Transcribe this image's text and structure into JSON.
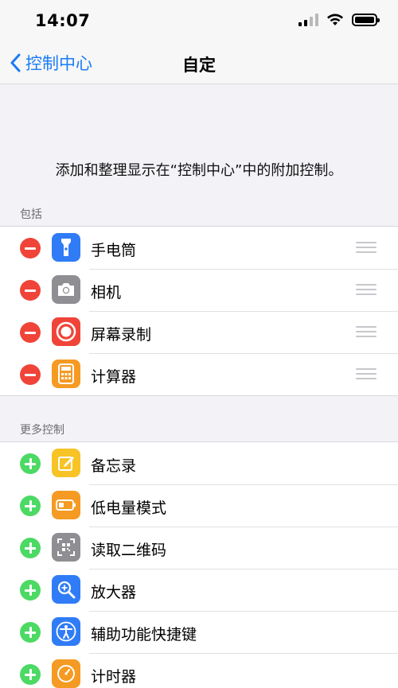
{
  "status_bar": {
    "time": "14:07"
  },
  "nav": {
    "back_label": "控制中心",
    "title": "自定"
  },
  "description": "添加和整理显示在“控制中心”中的附加控制。",
  "included": {
    "header": "包括",
    "items": [
      {
        "label": "手电筒",
        "icon": "flashlight-icon",
        "color": "#2f7cf6"
      },
      {
        "label": "相机",
        "icon": "camera-icon",
        "color": "#8e8e93"
      },
      {
        "label": "屏幕录制",
        "icon": "screen-record-icon",
        "color": "#f04438"
      },
      {
        "label": "计算器",
        "icon": "calculator-icon",
        "color": "#f59a23"
      }
    ]
  },
  "more": {
    "header": "更多控制",
    "items": [
      {
        "label": "备忘录",
        "icon": "notes-icon",
        "color": "#f7c325"
      },
      {
        "label": "低电量模式",
        "icon": "low-power-icon",
        "color": "#f59a23"
      },
      {
        "label": "读取二维码",
        "icon": "qr-code-icon",
        "color": "#8e8e93"
      },
      {
        "label": "放大器",
        "icon": "magnifier-icon",
        "color": "#2f7cf6"
      },
      {
        "label": "辅助功能快捷键",
        "icon": "accessibility-icon",
        "color": "#2f7cf6"
      },
      {
        "label": "计时器",
        "icon": "timer-icon",
        "color": "#f59a23"
      }
    ]
  },
  "colors": {
    "accent": "#1a7cf5",
    "remove": "#f04438",
    "add": "#4cd964"
  }
}
